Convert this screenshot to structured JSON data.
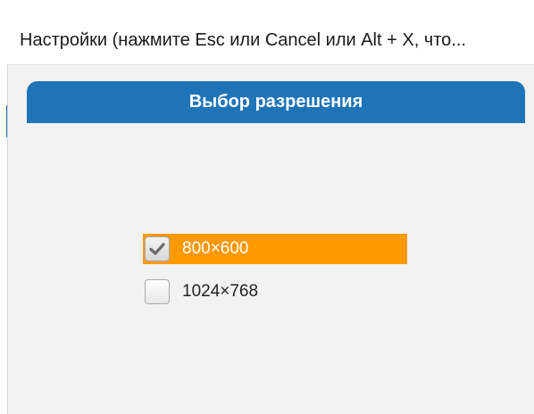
{
  "window": {
    "title": "Настройки (нажмите Esc или Cancel или Alt + X, что..."
  },
  "panel": {
    "header": "Выбор разрешения"
  },
  "options": [
    {
      "label": "800×600",
      "checked": true,
      "selected": true
    },
    {
      "label": "1024×768",
      "checked": false,
      "selected": false
    }
  ],
  "colors": {
    "header_bg": "#1f74b8",
    "selected_bg": "#ff9900",
    "content_bg": "#f2f2f2"
  },
  "icons": {
    "check": "check-icon"
  }
}
